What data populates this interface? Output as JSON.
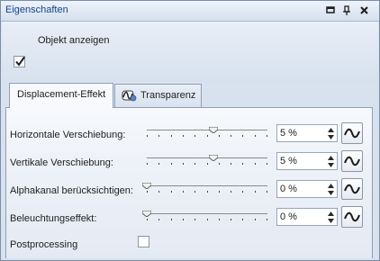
{
  "window": {
    "title": "Eigenschaften",
    "buttons": [
      "pin-icon",
      "float-icon",
      "close-icon"
    ]
  },
  "show_object": {
    "label": "Objekt anzeigen",
    "checked": true
  },
  "tabs": [
    {
      "label": "Displacement-Effekt",
      "active": true
    },
    {
      "label": "Transparenz",
      "active": false,
      "icon": "transparency-curve-icon"
    }
  ],
  "rows": [
    {
      "label": "Horizontale Verschiebung:",
      "value": "5 %",
      "slider_fraction": 0.55
    },
    {
      "label": "Vertikale Verschiebung:",
      "value": "5 %",
      "slider_fraction": 0.55
    },
    {
      "label": "Alphakanal berücksichtigen:",
      "value": "0 %",
      "slider_fraction": 0.0
    },
    {
      "label": "Beleuchtungseffekt:",
      "value": "0 %",
      "slider_fraction": 0.0
    }
  ],
  "postprocessing": {
    "label": "Postprocessing",
    "checked": false
  },
  "colors": {
    "title_text": "#15428b",
    "panel_border": "#7d8ea8",
    "tab_border": "#8f9fb6"
  }
}
